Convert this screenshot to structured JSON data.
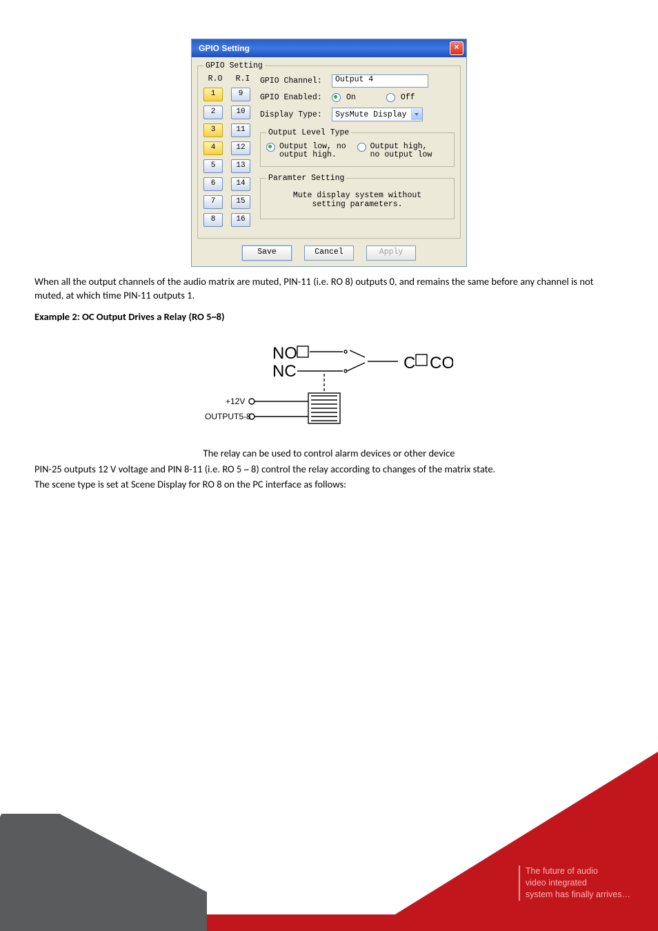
{
  "dialog": {
    "title": "GPIO Setting",
    "fieldset_label": "GPIO Setting",
    "ro_label": "R.O",
    "ri_label": "R.I",
    "selected_ports": [
      1,
      3,
      4
    ],
    "channel_label": "GPIO Channel:",
    "channel_value": "Output 4",
    "enabled_label": "GPIO Enabled:",
    "radio_on": "On",
    "radio_off": "Off",
    "enabled_state": "on",
    "display_type_label": "Display Type:",
    "display_type_value": "SysMute Display",
    "output_level_legend": "Output Level Type",
    "out_low_label_line1": "Output low, no",
    "out_low_label_line2": "output high.",
    "out_high_label_line1": "Output high,",
    "out_high_label_line2": "no output low",
    "output_level_selected": "low",
    "param_legend": "Paramter Setting",
    "param_msg_line1": "Mute display system without",
    "param_msg_line2": "setting parameters.",
    "btn_save": "Save",
    "btn_cancel": "Cancel",
    "btn_apply": "Apply"
  },
  "body": {
    "p1": "When all the output channels of the audio matrix are muted, PIN-11 (i.e. RO 8) outputs 0, and remains the same before any channel is not muted, at which time PIN-11 outputs 1.",
    "example2": "Example 2: OC Output Drives a Relay (RO 5~8)",
    "fig_caption": "The relay can be used to control alarm devices or other device",
    "p2": "PIN-25 outputs 12 V voltage and PIN 8-11 (i.e. RO 5 ~ 8) control the relay according to changes of the matrix state.",
    "p3": "The scene type is set at Scene Display for RO 8 on the PC interface as follows:"
  },
  "figure": {
    "no": "NO",
    "nc": "NC",
    "com": "COM",
    "v12": "+12V",
    "out": "OUTPUT5-8"
  },
  "footer": {
    "line1": "The future of audio",
    "line2": "video integrated",
    "line3": "system has finally arrives…"
  }
}
